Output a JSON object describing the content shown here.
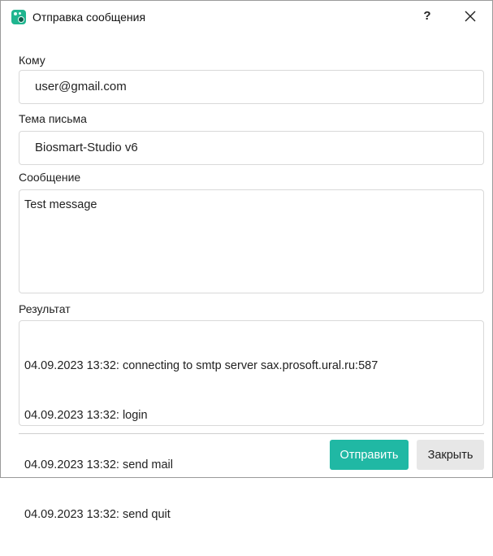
{
  "window": {
    "title": "Отправка сообщения",
    "help_label": "?",
    "icons": {
      "app": "biosmart-app-icon",
      "close": "close-icon"
    }
  },
  "form": {
    "to_label": "Кому",
    "to_value": "user@gmail.com",
    "subject_label": "Тема письма",
    "subject_value": "Biosmart-Studio v6",
    "message_label": "Сообщение",
    "message_value": "Test message",
    "result_label": "Результат",
    "result_lines": [
      "04.09.2023 13:32: connecting to smtp server sax.prosoft.ural.ru:587",
      "04.09.2023 13:32: login",
      "04.09.2023 13:32: send mail",
      "04.09.2023 13:32: send quit"
    ]
  },
  "buttons": {
    "send_label": "Отправить",
    "close_label": "Закрыть"
  },
  "colors": {
    "accent": "#20b8a4",
    "secondary_button": "#e7e7e7",
    "border": "#d9d9d9"
  }
}
